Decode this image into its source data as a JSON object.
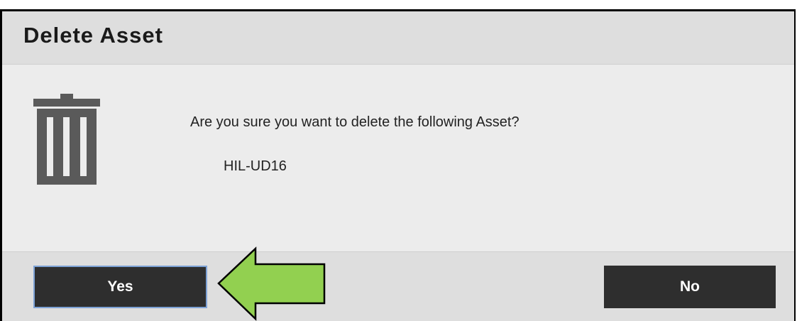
{
  "dialog": {
    "title": "Delete Asset",
    "message": "Are you sure you want to delete the following Asset?",
    "asset_name": "HIL-UD16",
    "icon": "trash-icon"
  },
  "buttons": {
    "yes_label": "Yes",
    "no_label": "No"
  },
  "annotation": {
    "arrow_color": "#92d050",
    "arrow_direction": "left"
  }
}
